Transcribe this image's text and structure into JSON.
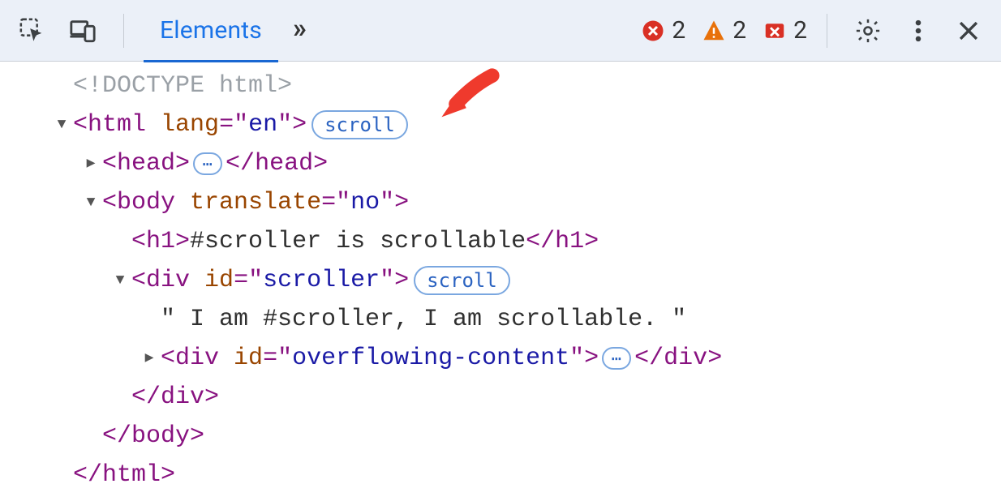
{
  "toolbar": {
    "tab_elements_label": "Elements",
    "more_tabs_glyph": "»",
    "errors_count": "2",
    "warnings_count": "2",
    "issues_count": "2"
  },
  "tree": {
    "doctype_text": "<!DOCTYPE html>",
    "html_open_prefix": "<",
    "html_tag": "html",
    "html_attr_name": "lang",
    "html_attr_eq": "=\"",
    "html_attr_val": "en",
    "html_attr_close": "\">",
    "scroll_badge": "scroll",
    "head_open": "<",
    "head_tag": "head",
    "head_open_close": ">",
    "ellipsis": "⋯",
    "head_close_open": "</",
    "head_close_close": ">",
    "body_open_prefix": "<",
    "body_tag": "body",
    "body_attr_name": "translate",
    "body_attr_eq": "=\"",
    "body_attr_val": "no",
    "body_attr_close": "\">",
    "h1_open": "<",
    "h1_tag": "h1",
    "h1_open_close": ">",
    "h1_text": "#scroller is scrollable",
    "h1_close_open": "</",
    "h1_close_close": ">",
    "div_scroller_open": "<",
    "div_tag": "div",
    "id_attr": "id",
    "attr_eq": "=\"",
    "scroller_id_val": "scroller",
    "attr_close": "\">",
    "scroller_text": "\" I am #scroller, I am scrollable. \"",
    "overflow_id_val": "overflowing-content",
    "div_close_open": "</",
    "div_close_close": ">",
    "body_close_open": "</",
    "body_close_close": ">",
    "html_close_open": "</",
    "html_close_close": ">"
  }
}
